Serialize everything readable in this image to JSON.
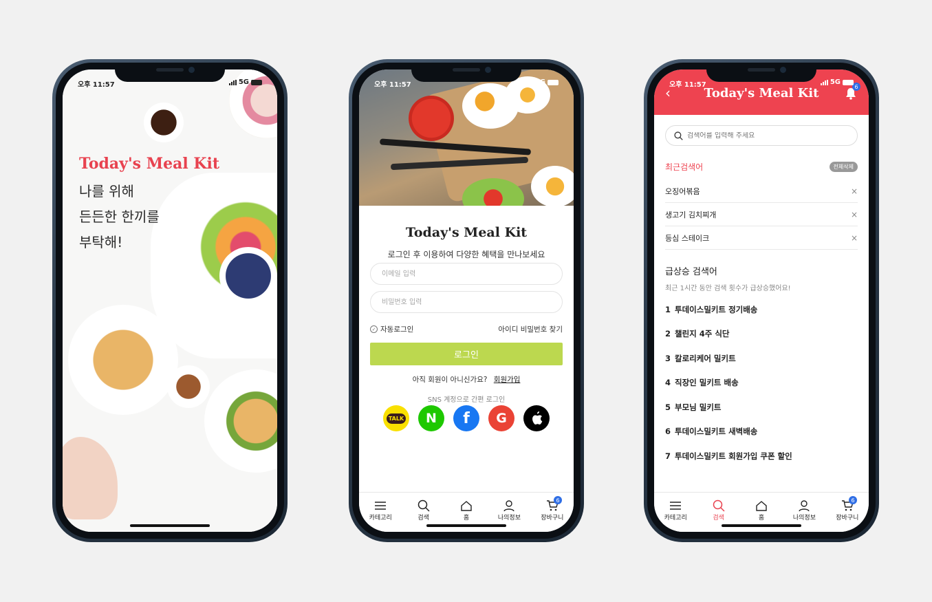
{
  "status": {
    "time": "오후 11:57",
    "network": "5G"
  },
  "splash": {
    "brand": "Today's Meal Kit",
    "lines": [
      "나를 위해",
      "든든한 한끼를",
      "부탁해!"
    ]
  },
  "login": {
    "title": "Today's Meal Kit",
    "subtitle": "로그인 후 이용하여 다양한 혜택을 만나보세요",
    "email_placeholder": "이메일 입력",
    "password_placeholder": "비밀번호 입력",
    "auto_login": "자동로그인",
    "find_account": "아이디 비밀번호 찾기",
    "login_button": "로그인",
    "not_member": "아직 회원이 아니신가요?",
    "signup": "회원가입",
    "sns_label": "SNS 계정으로 간편 로그인",
    "sns": [
      {
        "name": "kakao",
        "label": "TALK",
        "color": "#f9e000"
      },
      {
        "name": "naver",
        "label": "N",
        "color": "#1ec800"
      },
      {
        "name": "facebook",
        "label": "f",
        "color": "#1877f2"
      },
      {
        "name": "google",
        "label": "G",
        "color": "#ea4335"
      },
      {
        "name": "apple",
        "label": "",
        "color": "#000000"
      }
    ]
  },
  "tabbar": {
    "items": [
      "카테고리",
      "검색",
      "홈",
      "나의정보",
      "장바구니"
    ],
    "cart_badge": "6"
  },
  "search": {
    "header_title": "Today's Meal Kit",
    "notification_badge": "6",
    "placeholder": "검색어를 입력해 주세요",
    "recent_title": "최근검색어",
    "clear_all": "전체삭제",
    "recent": [
      "오징어볶음",
      "생고기 김치찌개",
      "등심 스테이크"
    ],
    "rising_title": "급상승 검색어",
    "rising_sub": "최근 1시간 동안 검색 횟수가 급상승했어요!",
    "rising": [
      {
        "rank": "1",
        "term": "투데이스밀키트 정기배송"
      },
      {
        "rank": "2",
        "term": "챌린지 4주 식단"
      },
      {
        "rank": "3",
        "term": "칼로리케어 밀키트"
      },
      {
        "rank": "4",
        "term": "직장인 밀키트 배송"
      },
      {
        "rank": "5",
        "term": "부모님 밀키트"
      },
      {
        "rank": "6",
        "term": "투데이스밀키트 새벽배송"
      },
      {
        "rank": "7",
        "term": "투데이스밀키트 회원가입 쿠폰 할인"
      }
    ],
    "accent": "#ee4350"
  }
}
